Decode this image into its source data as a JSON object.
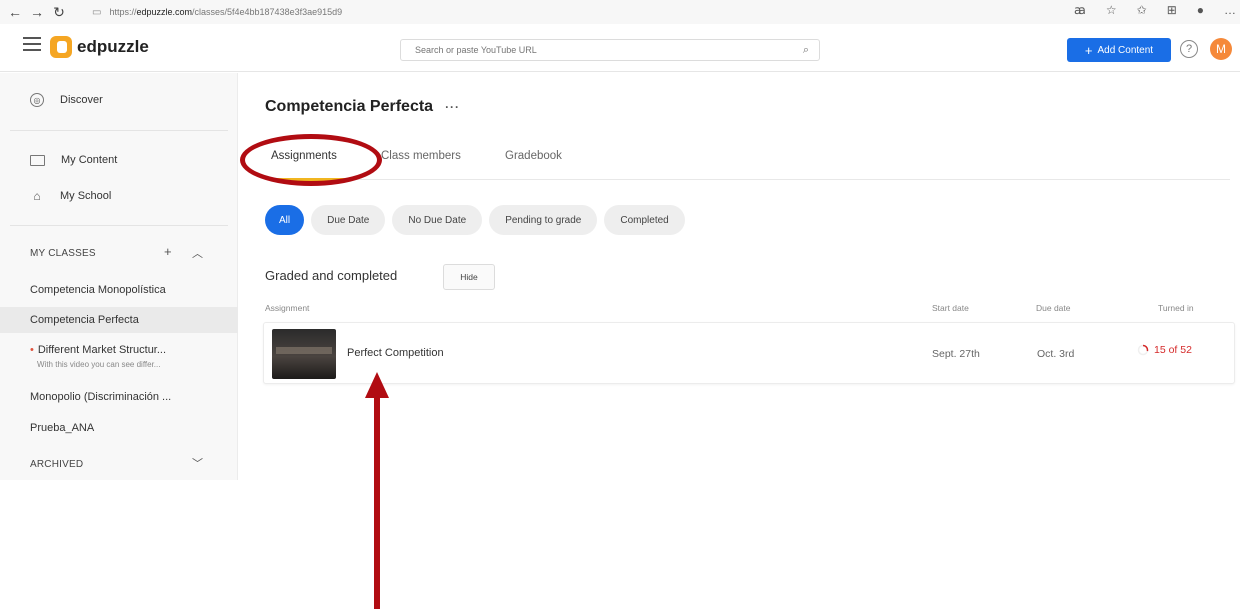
{
  "browser": {
    "url_prefix": "https://",
    "url_domain": "edpuzzle.com",
    "url_path": "/classes/5f4e4bb187438e3f3ae915d9",
    "icons": [
      "back-icon",
      "forward-icon",
      "refresh-icon",
      "lock-icon",
      "read-aloud-icon",
      "favorite-icon",
      "favorites-bar-icon",
      "collections-icon",
      "profile-icon",
      "more-icon"
    ]
  },
  "header": {
    "logo_text": "edpuzzle",
    "search_placeholder": "Search or paste YouTube URL",
    "add_content_label": "Add Content",
    "help_label": "?",
    "avatar_initial": "M"
  },
  "sidebar": {
    "discover": "Discover",
    "my_content": "My Content",
    "my_school": "My School",
    "my_classes_heading": "MY CLASSES",
    "classes": [
      "Competencia Monopolística",
      "Competencia Perfecta"
    ],
    "sub_item": {
      "title": "Different Market Structur...",
      "desc": "With this video you can see differ..."
    },
    "more_classes": [
      "Monopolio (Discriminación ...",
      "Prueba_ANA"
    ],
    "archived_heading": "ARCHIVED"
  },
  "main": {
    "title": "Competencia Perfecta",
    "more_label": "···",
    "tabs": [
      "Assignments",
      "Class members",
      "Gradebook"
    ],
    "filters": [
      "All",
      "Due Date",
      "No Due Date",
      "Pending to grade",
      "Completed"
    ],
    "section_title": "Graded and completed",
    "hide_label": "Hide",
    "columns": {
      "assignment": "Assignment",
      "start_date": "Start date",
      "due_date": "Due date",
      "turned_in": "Turned in"
    },
    "rows": [
      {
        "title": "Perfect Competition",
        "start": "Sept. 27th",
        "due": "Oct. 3rd",
        "turned_in": "15 of 52",
        "turned_fraction": 0.288
      }
    ]
  },
  "colors": {
    "primary": "#1a6ee6",
    "accent": "#f1b620",
    "annotation": "#b10c12",
    "turned_in": "#d52a2a"
  }
}
